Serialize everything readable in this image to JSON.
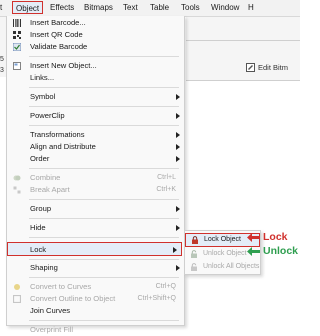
{
  "menubar": {
    "items": [
      {
        "label": "t"
      },
      {
        "label": "Object"
      },
      {
        "label": "Effects"
      },
      {
        "label": "Bitmaps"
      },
      {
        "label": "Text"
      },
      {
        "label": "Table"
      },
      {
        "label": "Tools"
      },
      {
        "label": "Window"
      },
      {
        "label": "H"
      }
    ]
  },
  "backdrop": {
    "left_fragment_1": "5",
    "left_fragment_2": "3",
    "edit_bitmap_label": "Edit Bitm"
  },
  "menu": {
    "items": [
      {
        "label": "Insert Barcode..."
      },
      {
        "label": "Insert QR Code"
      },
      {
        "label": "Validate Barcode"
      },
      {
        "label": "Insert New Object..."
      },
      {
        "label": "Links..."
      },
      {
        "label": "Symbol"
      },
      {
        "label": "PowerClip"
      },
      {
        "label": "Transformations"
      },
      {
        "label": "Align and Distribute"
      },
      {
        "label": "Order"
      },
      {
        "label": "Combine",
        "shortcut": "Ctrl+L"
      },
      {
        "label": "Break Apart",
        "shortcut": "Ctrl+K"
      },
      {
        "label": "Group"
      },
      {
        "label": "Hide"
      },
      {
        "label": "Lock"
      },
      {
        "label": "Shaping"
      },
      {
        "label": "Convert to Curves",
        "shortcut": "Ctrl+Q"
      },
      {
        "label": "Convert Outline to Object",
        "shortcut": "Ctrl+Shift+Q"
      },
      {
        "label": "Join Curves"
      },
      {
        "label": "Overprint Fill"
      }
    ]
  },
  "submenu": {
    "items": [
      {
        "label": "Lock Object"
      },
      {
        "label": "Unlock Object"
      },
      {
        "label": "Unlock All Objects"
      }
    ]
  },
  "callouts": {
    "lock": {
      "label": "Lock",
      "color": "#d0312d"
    },
    "unlock": {
      "label": "Unlock",
      "color": "#2e9e4f"
    }
  },
  "colors": {
    "highlight_border": "#d0312d",
    "highlight_fill": "#e4edf8"
  }
}
